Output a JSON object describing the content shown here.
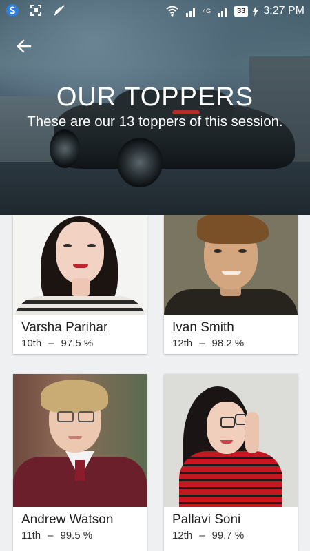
{
  "status_bar": {
    "time": "3:27 PM",
    "battery": "33",
    "network_label": "4G",
    "icons": [
      "s-logo-icon",
      "screenshot-icon",
      "no-sound-icon",
      "wifi-icon",
      "signal-icon",
      "battery-icon",
      "charging-icon"
    ]
  },
  "hero": {
    "title": "OUR TOPPERS",
    "subtitle": "These are our 13 toppers of this session."
  },
  "toppers": [
    {
      "name": "Varsha Parihar",
      "class": "10th",
      "percent": "97.5 %"
    },
    {
      "name": "Ivan Smith",
      "class": "12th",
      "percent": "98.2 %"
    },
    {
      "name": "Andrew Watson",
      "class": "11th",
      "percent": "99.5 %"
    },
    {
      "name": "Pallavi Soni",
      "class": "12th",
      "percent": "99.7 %"
    }
  ],
  "separator": "–",
  "colors": {
    "page_bg": "#eef0f2",
    "card_bg": "#ffffff",
    "text": "#222222"
  }
}
